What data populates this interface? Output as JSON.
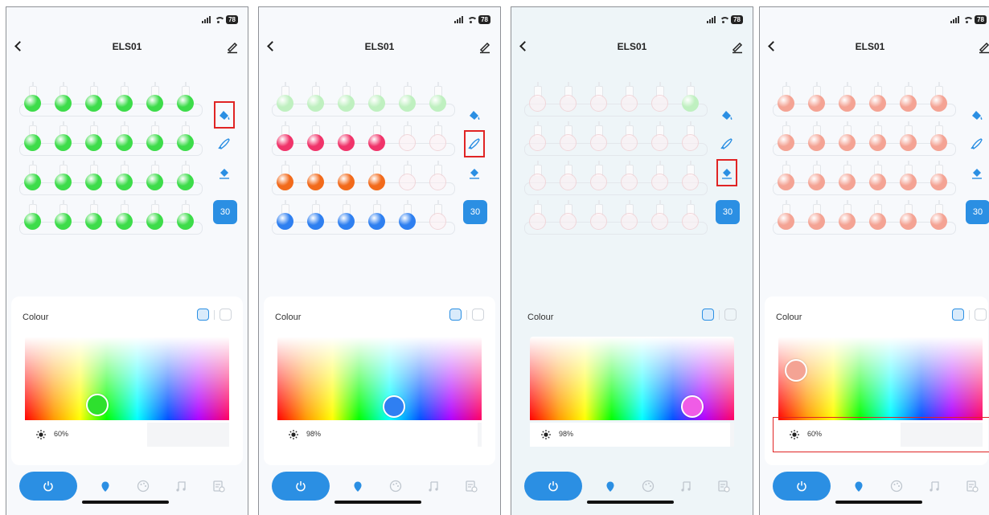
{
  "app": {
    "device_name": "ELS01"
  },
  "status": {
    "battery": "78"
  },
  "colors": {
    "accent": "#2b8fe3",
    "highlight": "#e02424",
    "green": "#3ddc4a",
    "red": "#f0346a",
    "orange": "#f26a1b",
    "blue": "#2e7ff0",
    "salmon": "#f4a394"
  },
  "panels": [
    {
      "title": "ELS01",
      "selected_tool": "paint-bucket",
      "count_label": "30",
      "colour_label": "Colour",
      "brightness_label": "60%",
      "brightness_level": 0.6,
      "knob_color": "#2ee02e",
      "bulbs": [
        [
          "green",
          "green",
          "green",
          "green",
          "green",
          "green"
        ],
        [
          "green",
          "green",
          "green",
          "green",
          "green",
          "green"
        ],
        [
          "green",
          "green",
          "green",
          "green",
          "green",
          "green"
        ],
        [
          "green",
          "green",
          "green",
          "green",
          "green",
          "green"
        ]
      ]
    },
    {
      "title": "ELS01",
      "selected_tool": "brush",
      "count_label": "30",
      "colour_label": "Colour",
      "brightness_label": "98%",
      "brightness_level": 0.98,
      "knob_color": "#2f7ff2",
      "bulbs": [
        [
          "palegreen",
          "palegreen",
          "palegreen",
          "palegreen",
          "palegreen",
          "palegreen"
        ],
        [
          "red",
          "red",
          "red",
          "red",
          "off",
          "off"
        ],
        [
          "orange",
          "orange",
          "orange",
          "orange",
          "off",
          "off"
        ],
        [
          "blue",
          "blue",
          "blue",
          "blue",
          "blue",
          "off"
        ]
      ]
    },
    {
      "title": "ELS01",
      "selected_tool": "eraser",
      "count_label": "30",
      "colour_label": "Colour",
      "brightness_label": "98%",
      "brightness_level": 0.98,
      "knob_color": "#f05ce6",
      "bulbs": [
        [
          "off",
          "off",
          "off",
          "off",
          "off",
          "palegreen"
        ],
        [
          "off",
          "off",
          "off",
          "off",
          "off",
          "off"
        ],
        [
          "off",
          "off",
          "off",
          "off",
          "off",
          "off"
        ],
        [
          "off",
          "off",
          "off",
          "off",
          "off",
          "off"
        ]
      ]
    },
    {
      "title": "ELS01",
      "selected_tool": "none",
      "count_label": "30",
      "colour_label": "Colour",
      "brightness_label": "60%",
      "brightness_level": 0.6,
      "knob_color": "#f4a394",
      "bulbs": [
        [
          "salmon",
          "salmon",
          "salmon",
          "salmon",
          "salmon",
          "salmon"
        ],
        [
          "salmon",
          "salmon",
          "salmon",
          "salmon",
          "salmon",
          "salmon"
        ],
        [
          "salmon",
          "salmon",
          "salmon",
          "salmon",
          "salmon",
          "salmon"
        ],
        [
          "salmon",
          "salmon",
          "salmon",
          "salmon",
          "salmon",
          "salmon"
        ]
      ]
    }
  ]
}
